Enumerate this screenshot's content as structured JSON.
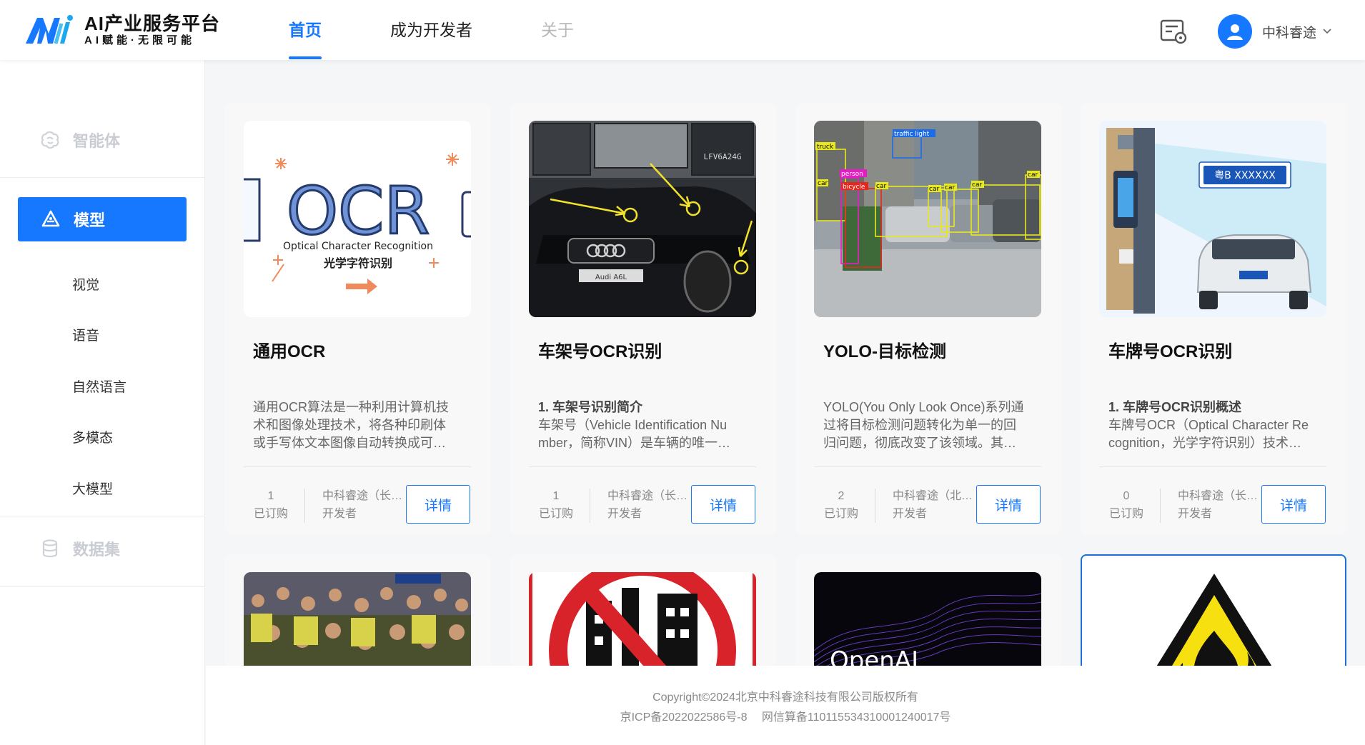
{
  "app": {
    "title": "AI产业服务平台",
    "subtitle": "AI赋能·无限可能"
  },
  "nav": {
    "items": [
      {
        "label": "首页",
        "state": "active"
      },
      {
        "label": "成为开发者",
        "state": "normal"
      },
      {
        "label": "关于",
        "state": "disabled"
      }
    ]
  },
  "user": {
    "name": "中科睿途"
  },
  "sidebar": {
    "groups": [
      {
        "label": "智能体"
      },
      {
        "label": "模型"
      },
      {
        "label": "数据集"
      }
    ],
    "model_items": [
      {
        "label": "视觉"
      },
      {
        "label": "语音"
      },
      {
        "label": "自然语言"
      },
      {
        "label": "多模态"
      },
      {
        "label": "大模型"
      }
    ]
  },
  "cards": [
    {
      "title": "通用OCR",
      "desc_heading": "",
      "desc_lines": [
        "通用OCR算法是一种利用计算机技",
        "术和图像处理技术，将各种印刷体",
        "或手写体文本图像自动转换成可…"
      ],
      "count": "1",
      "count_label": "已订购",
      "developer": "中科睿途（长…",
      "developer_label": "开发者",
      "button": "详情",
      "thumb_text": {
        "big": "OCR",
        "en": "Optical Character Recognition",
        "cn": "光学字符识别"
      }
    },
    {
      "title": "车架号OCR识别",
      "desc_heading": "1. 车架号识别简介",
      "desc_lines": [
        "车架号（Vehicle Identification Nu",
        "mber，简称VIN）是车辆的唯一…"
      ],
      "count": "1",
      "count_label": "已订购",
      "developer": "中科睿途（长…",
      "developer_label": "开发者",
      "button": "详情",
      "thumb_text": {
        "vin": "LFV6A24G",
        "badge": "Audi A6L"
      }
    },
    {
      "title": "YOLO-目标检测",
      "desc_heading": "",
      "desc_lines": [
        "YOLO(You Only Look Once)系列通",
        "过将目标检测问题转化为单一的回",
        "归问题，彻底改变了该领域。其…"
      ],
      "count": "2",
      "count_label": "已订购",
      "developer": "中科睿途（北…",
      "developer_label": "开发者",
      "button": "详情",
      "thumb_text": {
        "labels": [
          "truck",
          "traffic light",
          "person",
          "bicycle",
          "car",
          "car",
          "car",
          "car",
          "car",
          "car"
        ]
      }
    },
    {
      "title": "车牌号OCR识别",
      "desc_heading": "1. 车牌号OCR识别概述",
      "desc_lines": [
        "车牌号OCR（Optical Character Re",
        "cognition，光学字符识别）技术…"
      ],
      "count": "0",
      "count_label": "已订购",
      "developer": "中科睿途（长…",
      "developer_label": "开发者",
      "button": "详情",
      "thumb_text": {
        "plate": "粤B XXXXXX"
      }
    }
  ],
  "row2_thumbs": [
    {
      "name": "crowd-photo"
    },
    {
      "name": "no-construction-sign"
    },
    {
      "name": "openai-wave",
      "text": "OpenAI"
    },
    {
      "name": "fire-warning-sign"
    }
  ],
  "footer": {
    "copyright": "Copyright©2024北京中科睿途科技有限公司版权所有",
    "icp": "京ICP备2022022586号-8",
    "algo": "网信算备110115534310001240017号"
  },
  "colors": {
    "primary": "#1677ff",
    "selected_border": "#1c6fd8"
  }
}
